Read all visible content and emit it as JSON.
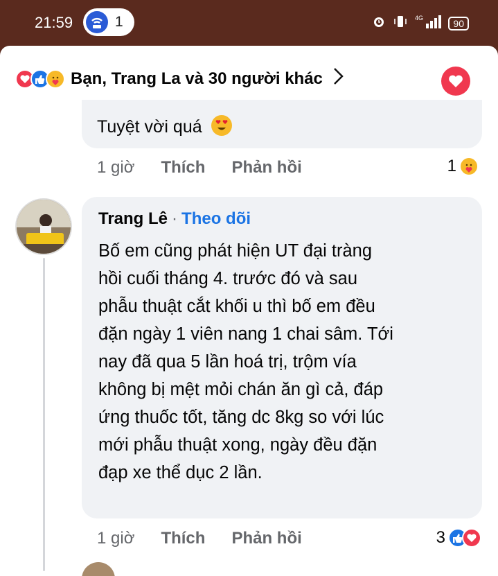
{
  "status_bar": {
    "time": "21:59",
    "notification_count": "1",
    "network": "4G",
    "battery": "90"
  },
  "reactions_bar": {
    "summary": "Bạn, Trang La và 30 người khác",
    "icons": [
      "love-icon",
      "like-icon",
      "care-icon"
    ]
  },
  "comment1": {
    "text": "Tuyệt vời quá",
    "emoji": "heart-eyes-emoji",
    "time": "1 giờ",
    "like_label": "Thích",
    "reply_label": "Phản hồi",
    "reaction_count": "1"
  },
  "comment2": {
    "author": "Trang Lê",
    "separator": "·",
    "follow_label": "Theo dõi",
    "lines": [
      "Bố em cũng phát hiện UT đại tràng",
      "hồi cuối tháng 4. trước đó và sau",
      "phẫu thuật cắt khối u thì bố em đều",
      "đặn ngày 1 viên nang 1 chai sâm. Tới",
      "nay đã qua 5 lần hoá trị, trộm vía",
      "không bị mệt mỏi chán ăn gì cả, đáp",
      "ứng thuốc tốt, tăng dc 8kg so với lúc",
      "mới phẫu thuật xong, ngày đều đặn",
      "đạp xe thể dục 2 lần."
    ],
    "time": "1 giờ",
    "like_label": "Thích",
    "reply_label": "Phản hồi",
    "reaction_count": "3"
  },
  "colors": {
    "status_bg": "#5a2a1e",
    "bubble_bg": "#f0f2f5",
    "link_blue": "#1b74e4",
    "love_red": "#f0384f"
  }
}
